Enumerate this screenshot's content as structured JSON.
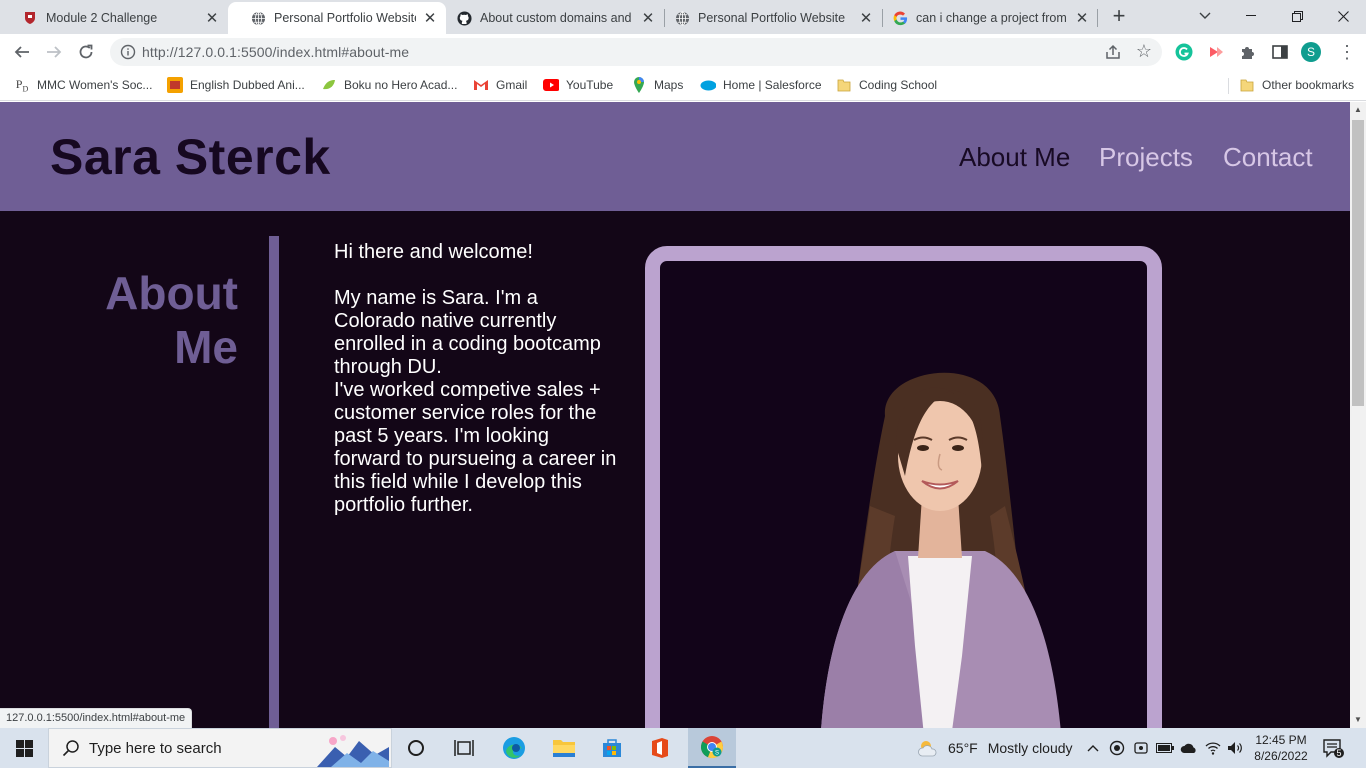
{
  "browser": {
    "tabs": [
      {
        "title": "Module 2 Challenge",
        "icon": "canvas-shield-icon",
        "active": false
      },
      {
        "title": "Personal Portfolio Website",
        "icon": "globe-icon",
        "active": true
      },
      {
        "title": "About custom domains and GitHub Pages",
        "icon": "github-icon",
        "active": false
      },
      {
        "title": "Personal Portfolio Website",
        "icon": "globe-icon",
        "active": false
      },
      {
        "title": "can i change a project from private to public",
        "icon": "google-icon",
        "active": false
      }
    ],
    "url": "http://127.0.0.1:5500/index.html#about-me",
    "bookmarks": [
      {
        "label": "MMC Women's Soc...",
        "icon": "pd-icon"
      },
      {
        "label": "English Dubbed Ani...",
        "icon": "anime-icon"
      },
      {
        "label": "Boku no Hero Acad...",
        "icon": "leaf-icon"
      },
      {
        "label": "Gmail",
        "icon": "gmail-icon"
      },
      {
        "label": "YouTube",
        "icon": "youtube-icon"
      },
      {
        "label": "Maps",
        "icon": "maps-icon"
      },
      {
        "label": "Home | Salesforce",
        "icon": "salesforce-icon"
      },
      {
        "label": "Coding School",
        "icon": "folder-icon"
      }
    ],
    "other_bookmarks": "Other bookmarks",
    "profile_initial": "S",
    "status_url": "127.0.0.1:5500/index.html#about-me"
  },
  "site": {
    "title": "Sara Sterck",
    "nav": [
      {
        "label": "About Me",
        "current": true
      },
      {
        "label": "Projects",
        "current": false
      },
      {
        "label": "Contact",
        "current": false
      }
    ],
    "about_heading_line1": "About",
    "about_heading_line2": "Me",
    "bio": {
      "greeting": "Hi there and welcome!",
      "paragraph1": "My name is Sara. I'm a Colorado native currently enrolled in a coding bootcamp through DU.",
      "paragraph2": "I've worked competive sales + customer service roles for the past 5 years. I'm looking forward to pursueing a career in this field while I develop this portfolio further."
    }
  },
  "taskbar": {
    "search_placeholder": "Type here to search",
    "weather_temp": "65°F",
    "weather_text": "Mostly cloudy",
    "time": "12:45 PM",
    "date": "8/26/2022",
    "notification_count": "5"
  },
  "colors": {
    "header_purple": "#6f5e95",
    "page_bg": "#130617",
    "frame_lilac": "#bba3cf",
    "nav_inactive": "#d7c7e6"
  }
}
